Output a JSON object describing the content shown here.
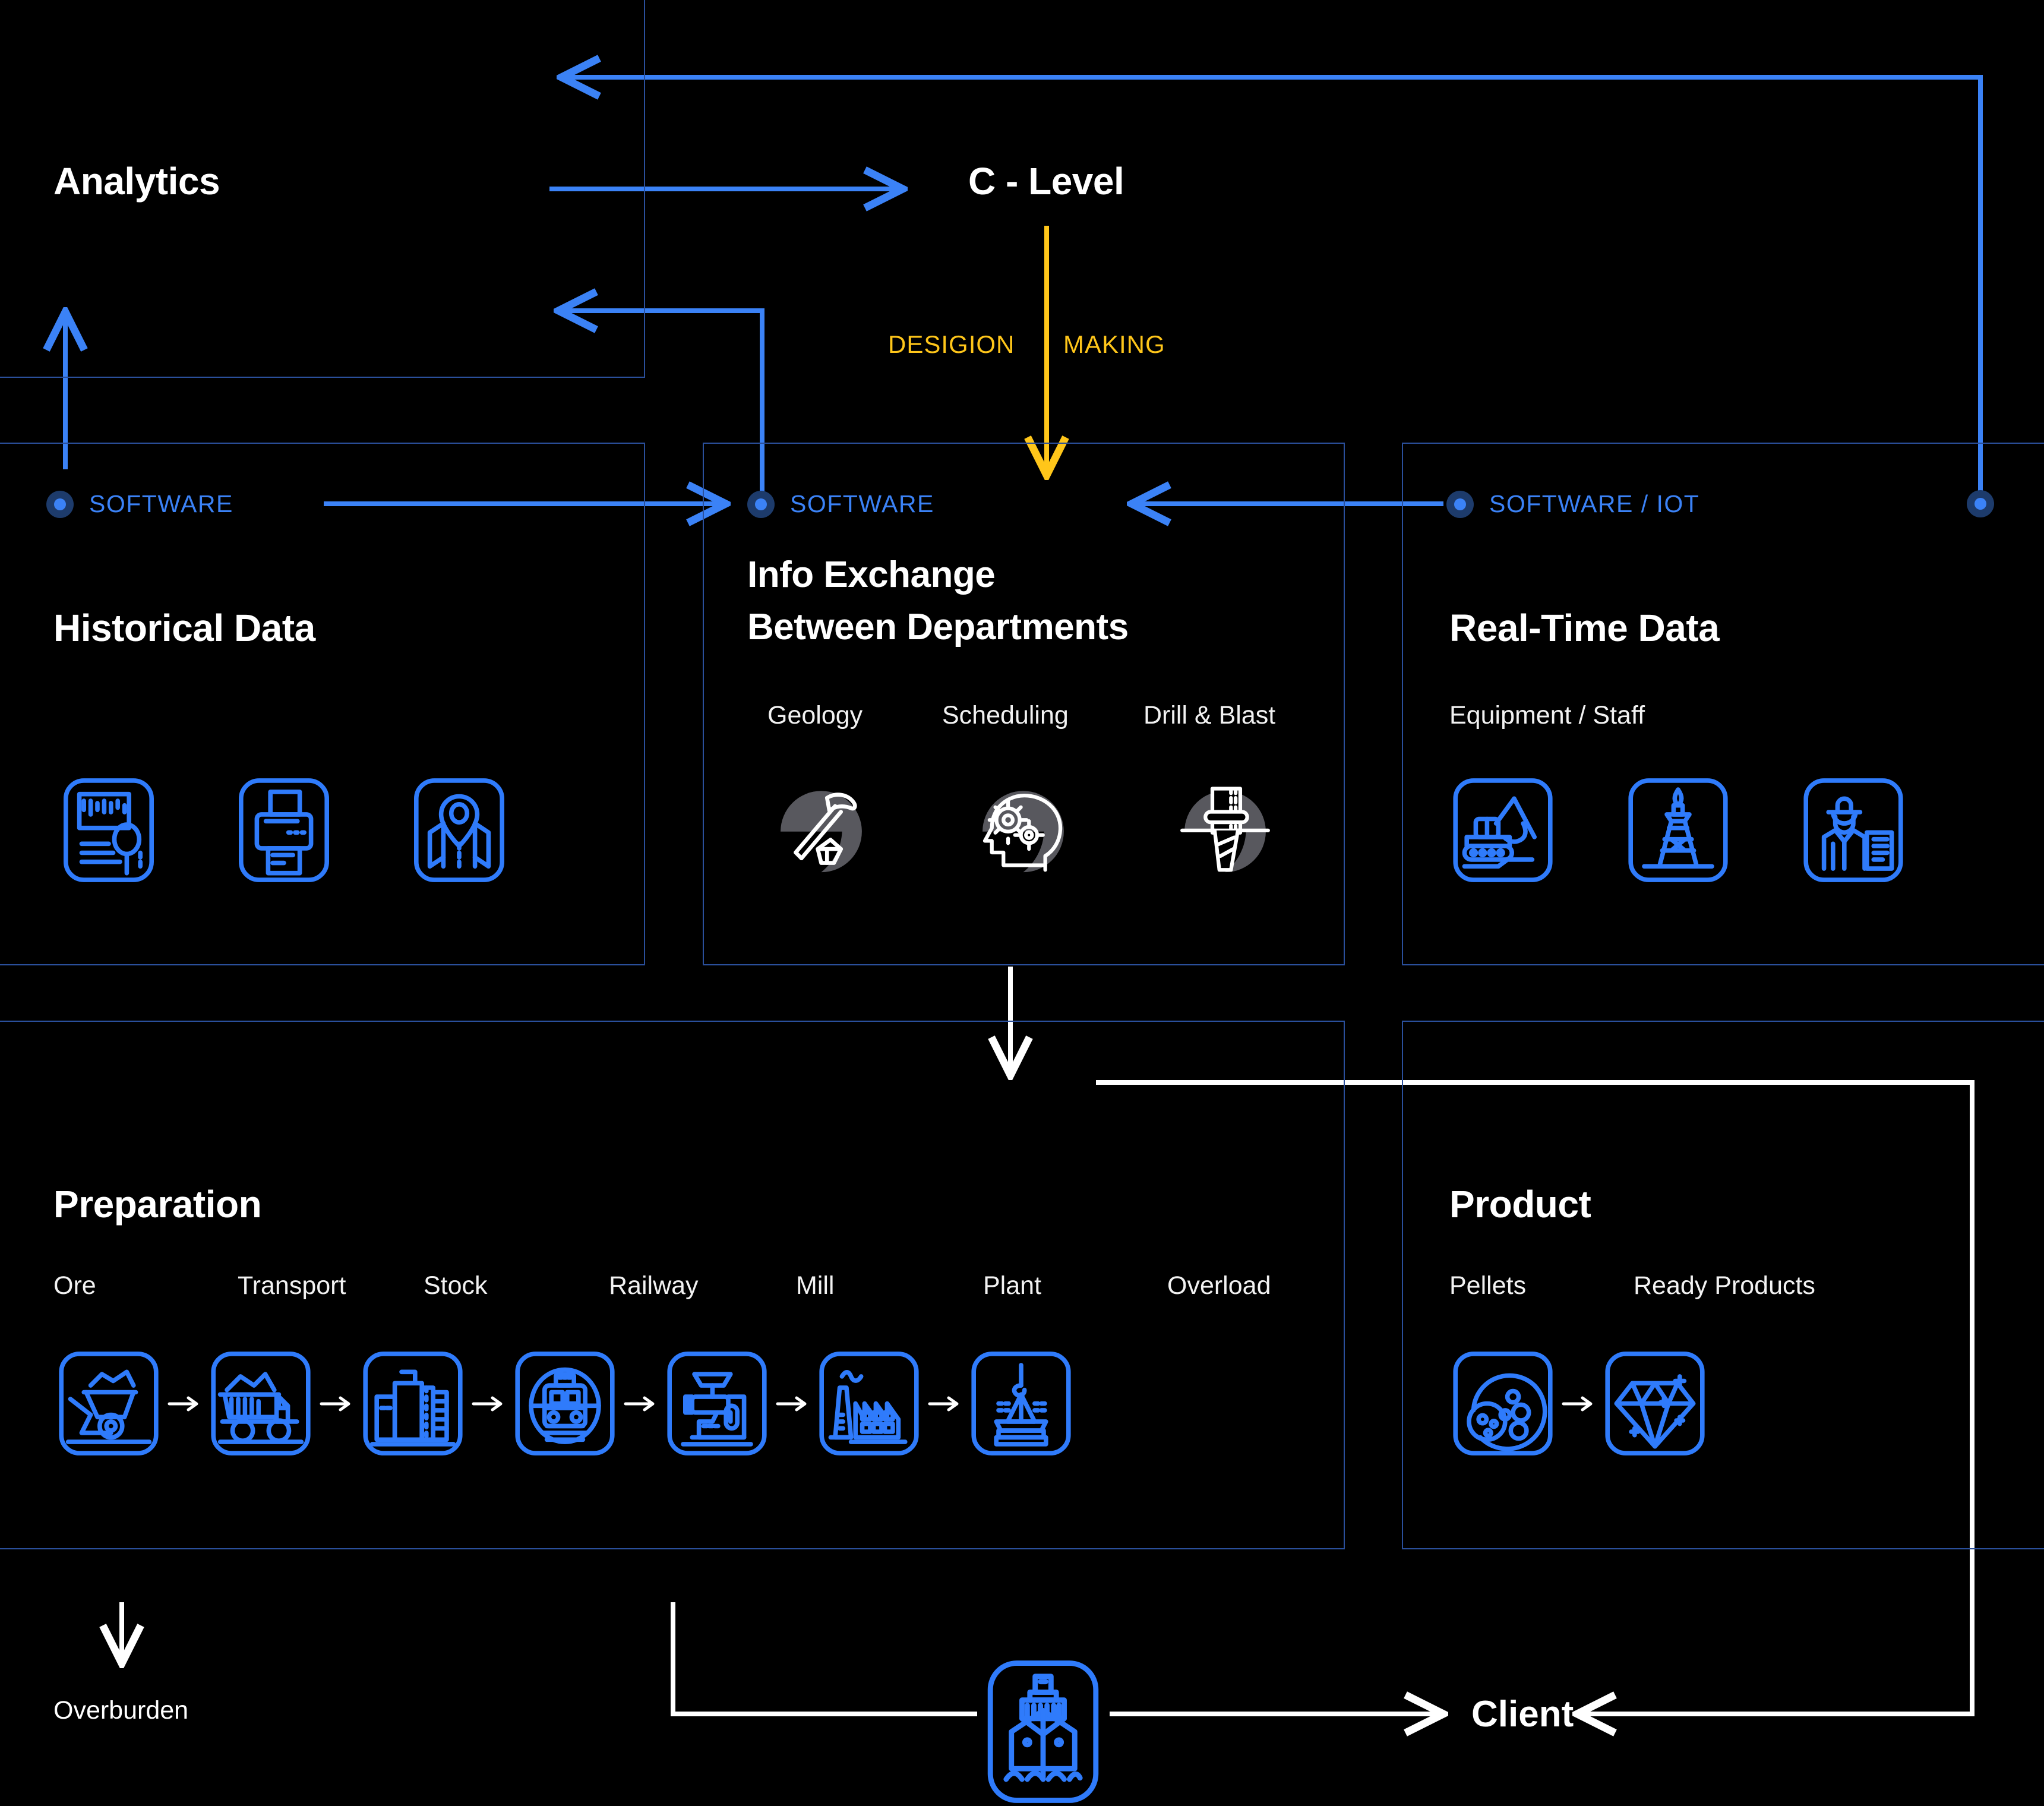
{
  "diagram": {
    "title_analytics": "Analytics",
    "title_clevel": "C - Level",
    "decision_label": "DESIGION  |  MAKING",
    "decision_left": "DESIGION",
    "decision_right": "MAKING",
    "client_label": "Client",
    "overburden_label": "Overburden",
    "accent_blue": "#3b82f6",
    "accent_yellow": "#ffc61a",
    "panel_border": "#2a4f9b",
    "white": "#ffffff",
    "background": "#000000"
  },
  "panels": {
    "historical": {
      "tag": "SOFTWARE",
      "title": "Historical Data",
      "icons": [
        {
          "name": "document-search-icon",
          "label": "document-search"
        },
        {
          "name": "printer-icon",
          "label": "printer"
        },
        {
          "name": "map-pin-icon",
          "label": "map-pin"
        }
      ]
    },
    "info_exchange": {
      "tag": "SOFTWARE",
      "title_line1": "Info Exchange",
      "title_line2": "Between Departments",
      "departments": [
        {
          "label": "Geology",
          "icon": "pickaxe-gem-icon"
        },
        {
          "label": "Scheduling",
          "icon": "head-gears-icon"
        },
        {
          "label": "Drill & Blast",
          "icon": "drill-bit-icon"
        }
      ]
    },
    "realtime": {
      "tag": "SOFTWARE / IOT",
      "title": "Real-Time Data",
      "subtitle": "Equipment / Staff",
      "icons": [
        {
          "name": "excavator-icon",
          "label": "excavator"
        },
        {
          "name": "drill-rig-icon",
          "label": "drill-rig"
        },
        {
          "name": "worker-clipboard-icon",
          "label": "worker"
        }
      ]
    },
    "preparation": {
      "title": "Preparation",
      "steps": [
        {
          "label": "Ore",
          "icon": "ore-cart-icon"
        },
        {
          "label": "Transport",
          "icon": "dump-truck-icon"
        },
        {
          "label": "Stock",
          "icon": "silo-icon"
        },
        {
          "label": "Railway",
          "icon": "train-icon"
        },
        {
          "label": "Mill",
          "icon": "mill-icon"
        },
        {
          "label": "Plant",
          "icon": "factory-icon"
        },
        {
          "label": "Overload",
          "icon": "crane-load-icon"
        }
      ]
    },
    "product": {
      "title": "Product",
      "steps": [
        {
          "label": "Pellets",
          "icon": "pellets-icon"
        },
        {
          "label": "Ready Products",
          "icon": "diamond-icon"
        }
      ]
    },
    "shipping": {
      "icon": "ship-icon"
    }
  }
}
